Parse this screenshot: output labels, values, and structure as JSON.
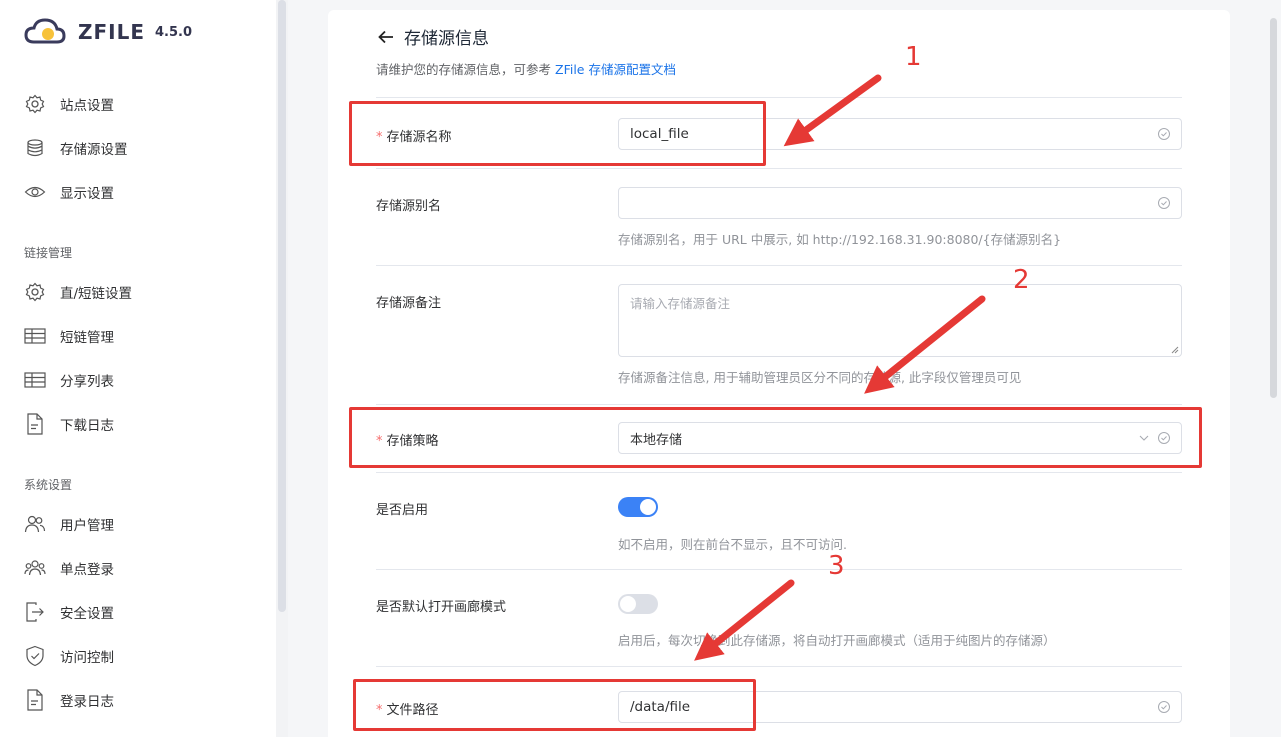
{
  "app": {
    "name": "ZFILE",
    "version": "4.5.0"
  },
  "sidebar": {
    "items_top": [
      {
        "label": "站点设置",
        "icon": "gear-icon"
      },
      {
        "label": "存储源设置",
        "icon": "database-icon"
      },
      {
        "label": "显示设置",
        "icon": "eye-icon"
      }
    ],
    "group_links": "链接管理",
    "items_links": [
      {
        "label": "直/短链设置",
        "icon": "gear-icon"
      },
      {
        "label": "短链管理",
        "icon": "table-icon"
      },
      {
        "label": "分享列表",
        "icon": "table-icon"
      },
      {
        "label": "下载日志",
        "icon": "document-icon"
      }
    ],
    "group_system": "系统设置",
    "items_system": [
      {
        "label": "用户管理",
        "icon": "users-icon"
      },
      {
        "label": "单点登录",
        "icon": "group-icon"
      },
      {
        "label": "安全设置",
        "icon": "logout-icon"
      },
      {
        "label": "访问控制",
        "icon": "shield-icon"
      },
      {
        "label": "登录日志",
        "icon": "document-icon"
      }
    ]
  },
  "page": {
    "title": "存储源信息",
    "subtitle_prefix": "请维护您的存储源信息，可参考",
    "subtitle_link": "ZFile 存储源配置文档"
  },
  "form": {
    "name": {
      "label": "存储源名称",
      "value": "local_file"
    },
    "alias": {
      "label": "存储源别名",
      "value": "",
      "hint": "存储源别名，用于 URL 中展示, 如 http://192.168.31.90:8080/{存储源别名}"
    },
    "remark": {
      "label": "存储源备注",
      "placeholder": "请输入存储源备注",
      "hint": "存储源备注信息, 用于辅助管理员区分不同的存储源, 此字段仅管理员可见"
    },
    "strategy": {
      "label": "存储策略",
      "value": "本地存储"
    },
    "enabled": {
      "label": "是否启用",
      "on": true,
      "hint": "如不启用，则在前台不显示，且不可访问."
    },
    "gallery": {
      "label": "是否默认打开画廊模式",
      "on": false,
      "hint": "启用后，每次切换到此存储源，将自动打开画廊模式（适用于纯图片的存储源）"
    },
    "path": {
      "label": "文件路径",
      "value": "/data/file"
    }
  },
  "annotations": {
    "n1": "1",
    "n2": "2",
    "n3": "3"
  },
  "colors": {
    "accent": "#3b82f6",
    "annotation": "#e53935",
    "link": "#1a73e8",
    "required": "#f56c6c"
  }
}
